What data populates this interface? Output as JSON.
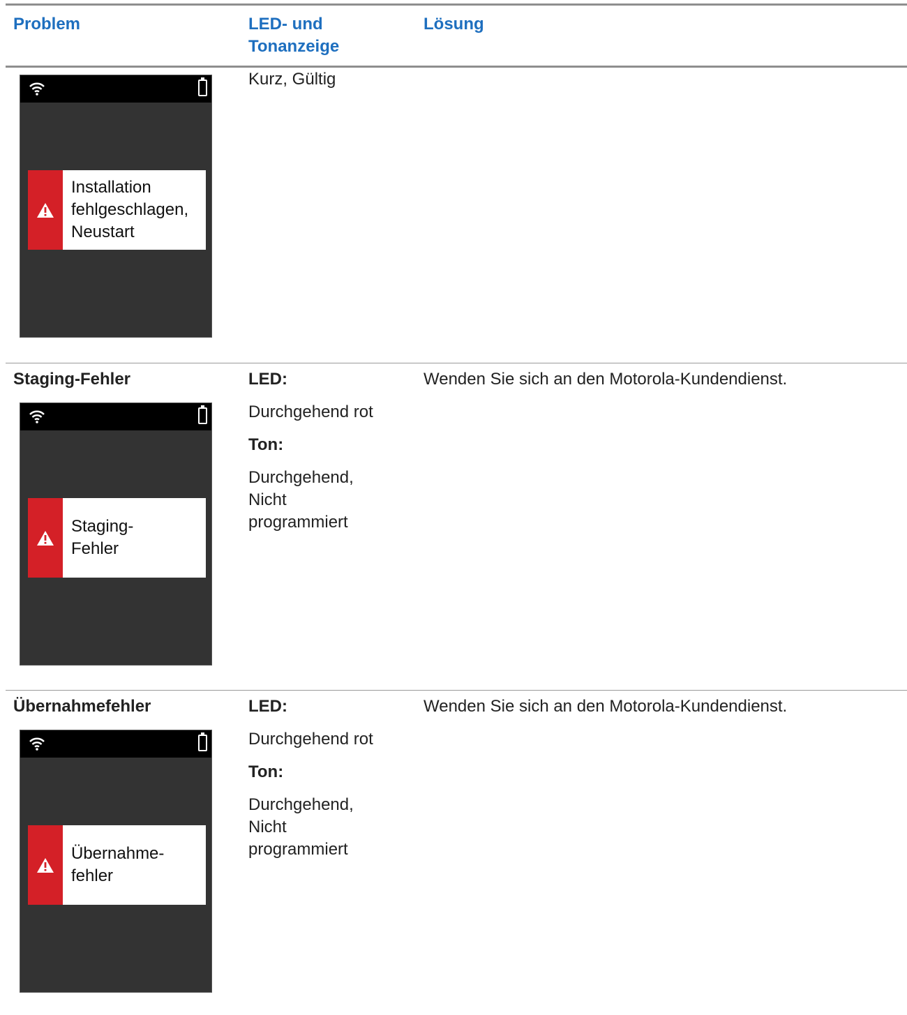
{
  "header": {
    "problem": "Problem",
    "indicator": "LED- und Tonanzeige",
    "solution": "Lösung"
  },
  "rows": [
    {
      "title": "",
      "screen_message": "Installation fehlgeschlagen, Neustart",
      "indicator_text": "Kurz, Gültig",
      "solution": ""
    },
    {
      "title": "Staging-Fehler",
      "screen_message": "Staging-Fehler",
      "led_label": "LED:",
      "led_value": "Durchgehend rot",
      "tone_label": "Ton:",
      "tone_value": "Durchgehend, Nicht programmiert",
      "solution": "Wenden Sie sich an den Motorola-Kundendienst."
    },
    {
      "title": "Übernahmefehler",
      "screen_message": "Übernahme-fehler",
      "led_label": "LED:",
      "led_value": "Durchgehend rot",
      "tone_label": "Ton:",
      "tone_value": "Durchgehend, Nicht programmiert",
      "solution": "Wenden Sie sich an den Motorola-Kundendienst."
    }
  ],
  "icons": {
    "wifi": "wifi-icon",
    "battery": "battery-icon",
    "warning": "warning-icon"
  },
  "colors": {
    "header_text": "#1e6fbf",
    "alert_red": "#d42027",
    "screen_bg": "#333333"
  }
}
